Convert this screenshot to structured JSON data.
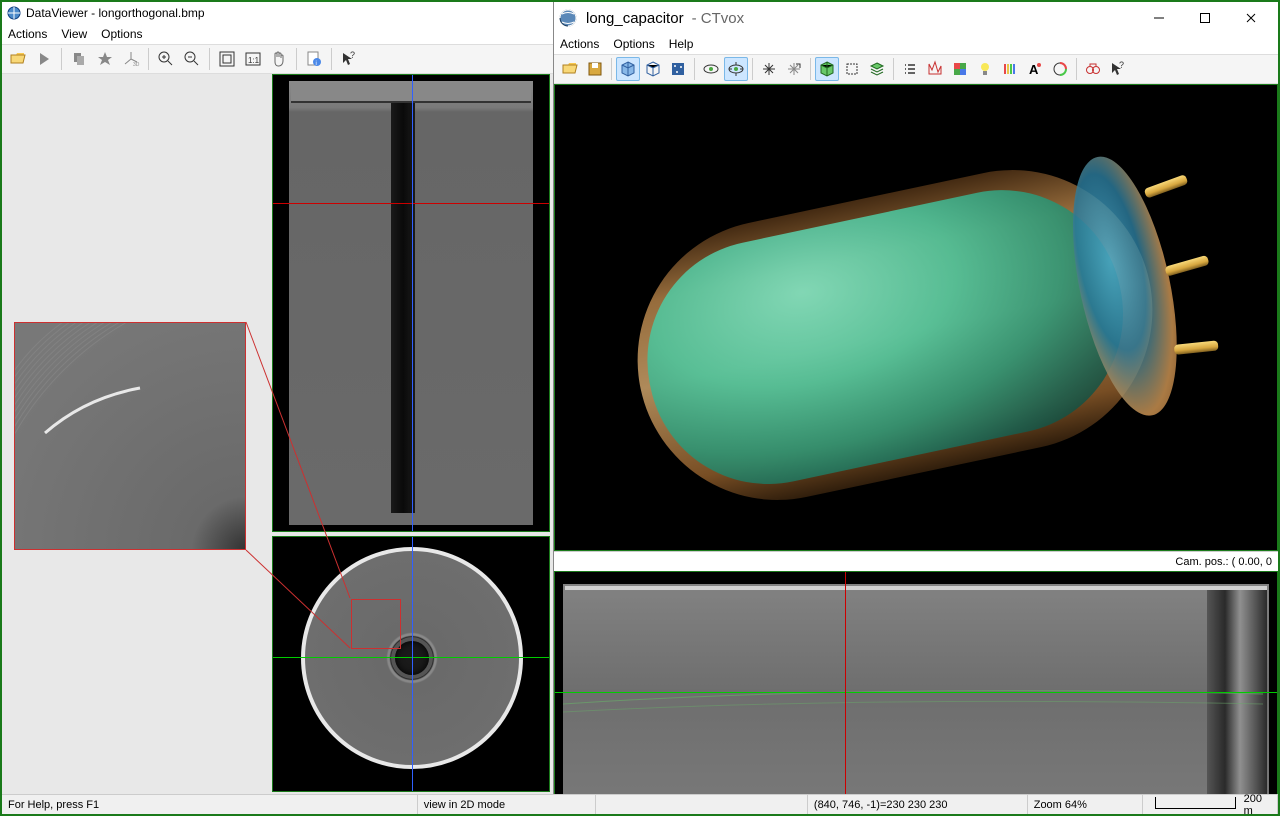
{
  "left": {
    "title_app": "DataViewer",
    "title_file": "longorthogonal.bmp",
    "menu": {
      "actions": "Actions",
      "view": "View",
      "options": "Options"
    }
  },
  "right": {
    "title_file": "long_capacitor",
    "title_app": "- CTvox",
    "menu": {
      "actions": "Actions",
      "options": "Options",
      "help": "Help"
    },
    "campos": "Cam. pos.: ( 0.00,  0"
  },
  "status": {
    "help": "For Help, press F1",
    "mode": "view in 2D mode",
    "coords": "(840, 746, -1)=230 230 230",
    "zoom": "Zoom 64%",
    "scale": "200 m"
  }
}
